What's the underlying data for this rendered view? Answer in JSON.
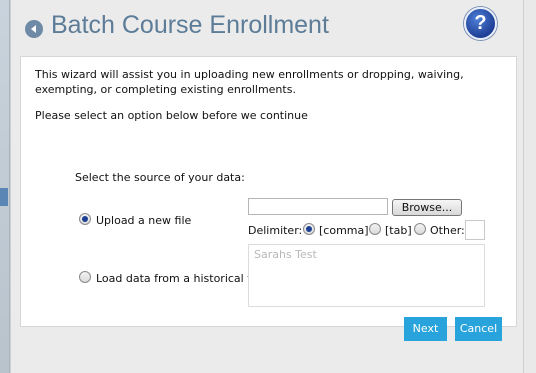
{
  "header": {
    "title": "Batch Course Enrollment",
    "help_glyph": "?",
    "back_icon": "back-arrow-icon",
    "help_icon": "help-icon"
  },
  "intro": {
    "text": "This wizard will assist you in uploading new enrollments or dropping, waiving, exempting, or completing existing enrollments.",
    "prompt": "Please select an option below before we continue"
  },
  "source": {
    "label": "Select the source of your data:",
    "options": [
      {
        "label": "Upload a new file",
        "selected": true
      },
      {
        "label": "Load data from a historical file",
        "selected": false
      }
    ],
    "file_value": "",
    "browse_label": "Browse...",
    "delimiter_label": "Delimiter:",
    "delimiters": [
      {
        "label": "[comma]",
        "selected": true
      },
      {
        "label": "[tab]",
        "selected": false
      },
      {
        "label": "Other:",
        "selected": false
      }
    ],
    "other_value": "",
    "notes_value": "Sarahs Test"
  },
  "footer": {
    "next_label": "Next",
    "cancel_label": "Cancel"
  },
  "colors": {
    "title": "#5c7c98",
    "button": "#29a3db",
    "help": "#1f3f96"
  }
}
